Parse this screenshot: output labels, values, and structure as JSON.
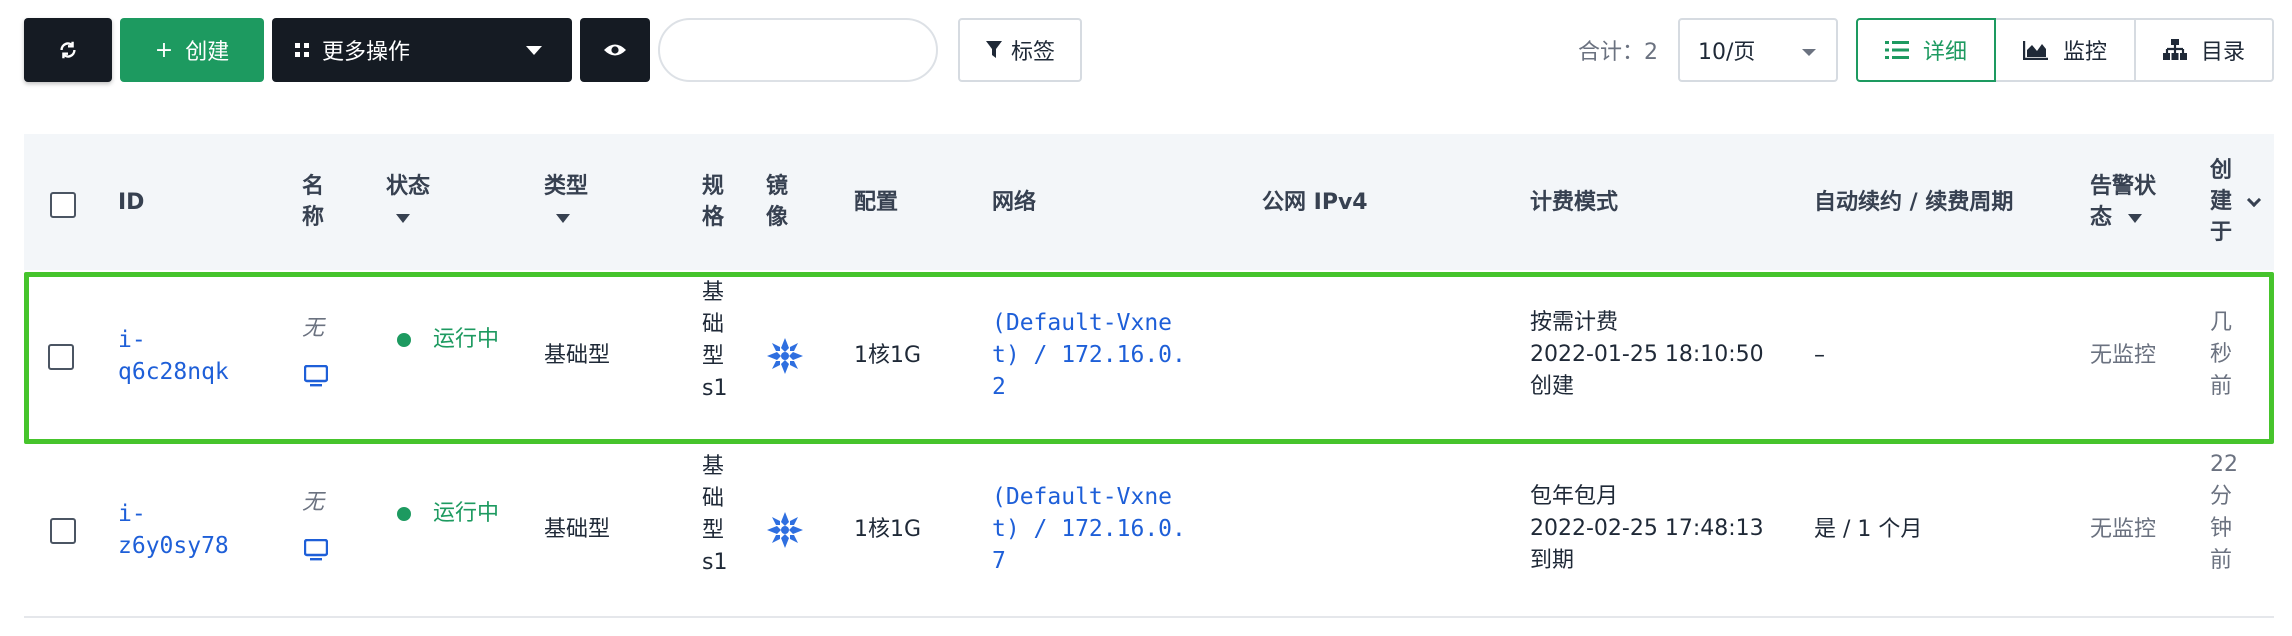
{
  "toolbar": {
    "refresh_icon": "refresh-icon",
    "create_label": "创建",
    "create_prefix": "+",
    "more_label": "更多操作",
    "eye_icon": "eye-icon",
    "search_value": "",
    "tag_label": "标签",
    "total_label": "合计：2",
    "page_size": "10/页",
    "views": [
      {
        "label": "详细",
        "icon": "list-icon",
        "active": true
      },
      {
        "label": "监控",
        "icon": "area-chart-icon",
        "active": false
      },
      {
        "label": "目录",
        "icon": "sitemap-icon",
        "active": false
      }
    ]
  },
  "table": {
    "headers": {
      "id": "ID",
      "name": "名称",
      "status": "状态",
      "type": "类型",
      "spec": "规格",
      "image": "镜像",
      "config": "配置",
      "network": "网络",
      "public_ip": "公网 IPv4",
      "billing": "计费模式",
      "renew": "自动续约 / 续费周期",
      "alarm": "告警状态",
      "created": "创建于"
    },
    "rows": [
      {
        "id": "i-q6c28nqk",
        "name": "无",
        "status": "运行中",
        "type": "基础型",
        "spec": "基础型s1",
        "config": "1核1G",
        "network": "(Default-Vxnet) / 172.16.0.2",
        "public_ip": "",
        "billing_mode": "按需计费",
        "billing_time": "2022-01-25 18:10:50",
        "billing_note": "创建",
        "renew": "–",
        "alarm": "无监控",
        "created": "几秒前",
        "highlighted": true
      },
      {
        "id": "i-z6y0sy78",
        "name": "无",
        "status": "运行中",
        "type": "基础型",
        "spec": "基础型s1",
        "config": "1核1G",
        "network": "(Default-Vxnet) / 172.16.0.7",
        "public_ip": "",
        "billing_mode": "包年包月",
        "billing_time": "2022-02-25 17:48:13",
        "billing_note": "到期",
        "renew": "是 / 1 个月",
        "alarm": "无监控",
        "created": "22分钟前",
        "highlighted": false
      }
    ]
  },
  "colors": {
    "primary_green": "#1d9a60",
    "highlight_green": "#46c42c",
    "link_blue": "#1e5fd8",
    "dark_button": "#151b23"
  }
}
